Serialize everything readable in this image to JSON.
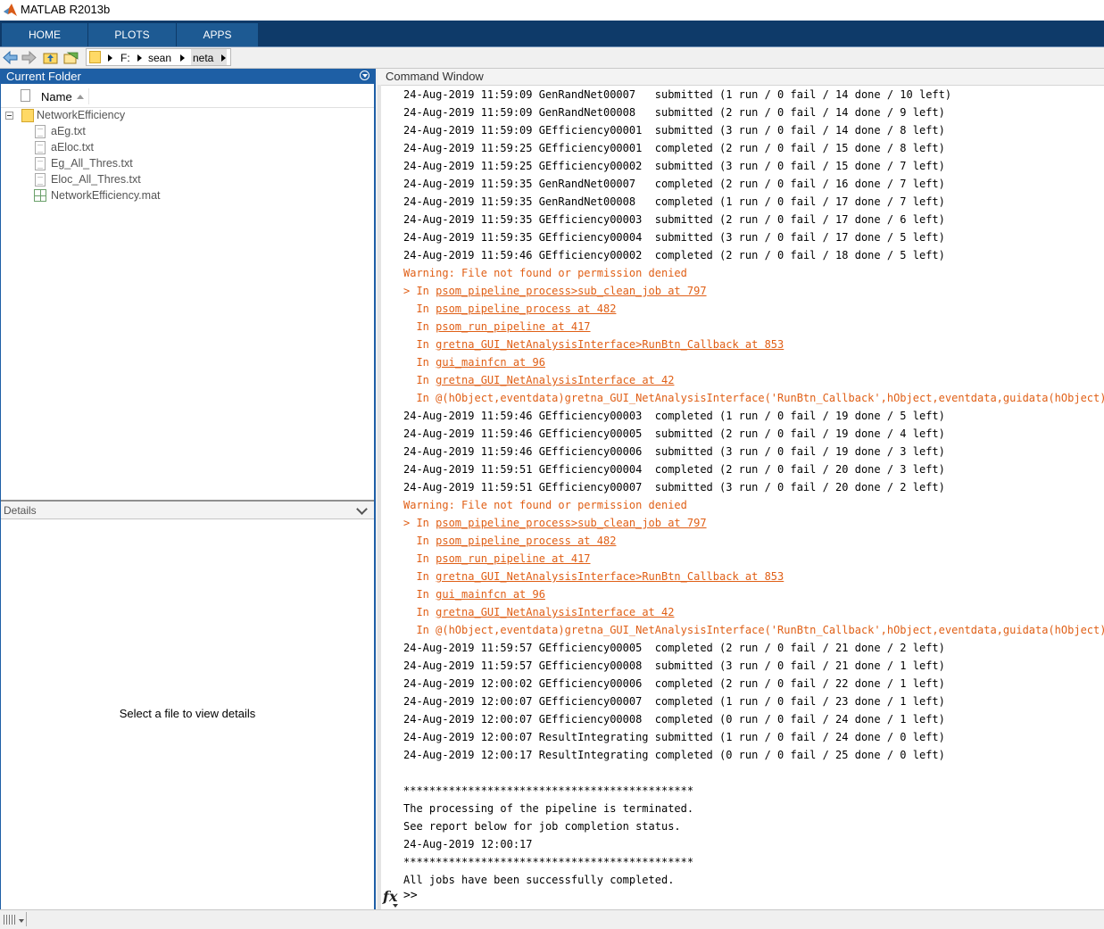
{
  "window": {
    "title": "MATLAB R2013b"
  },
  "ribbon": {
    "tabs": [
      "HOME",
      "PLOTS",
      "APPS"
    ]
  },
  "address_bar": {
    "crumbs": [
      "F:",
      "sean",
      "neta"
    ]
  },
  "current_folder": {
    "title": "Current Folder",
    "column_name": "Name",
    "root_folder": "NetworkEfficiency",
    "files": [
      "aEg.txt",
      "aEloc.txt",
      "Eg_All_Thres.txt",
      "Eloc_All_Thres.txt",
      "NetworkEfficiency.mat"
    ]
  },
  "details": {
    "title": "Details",
    "message": "Select a file to view details"
  },
  "command_window": {
    "title": "Command Window",
    "lines": [
      {
        "t": "24-Aug-2019 11:59:09 GenRandNet00007   submitted (1 run / 0 fail / 14 done / 10 left)",
        "k": "n"
      },
      {
        "t": "24-Aug-2019 11:59:09 GenRandNet00008   submitted (2 run / 0 fail / 14 done / 9 left)",
        "k": "n"
      },
      {
        "t": "24-Aug-2019 11:59:09 GEfficiency00001  submitted (3 run / 0 fail / 14 done / 8 left)",
        "k": "n"
      },
      {
        "t": "24-Aug-2019 11:59:25 GEfficiency00001  completed (2 run / 0 fail / 15 done / 8 left)",
        "k": "n"
      },
      {
        "t": "24-Aug-2019 11:59:25 GEfficiency00002  submitted (3 run / 0 fail / 15 done / 7 left)",
        "k": "n"
      },
      {
        "t": "24-Aug-2019 11:59:35 GenRandNet00007   completed (2 run / 0 fail / 16 done / 7 left)",
        "k": "n"
      },
      {
        "t": "24-Aug-2019 11:59:35 GenRandNet00008   completed (1 run / 0 fail / 17 done / 7 left)",
        "k": "n"
      },
      {
        "t": "24-Aug-2019 11:59:35 GEfficiency00003  submitted (2 run / 0 fail / 17 done / 6 left)",
        "k": "n"
      },
      {
        "t": "24-Aug-2019 11:59:35 GEfficiency00004  submitted (3 run / 0 fail / 17 done / 5 left)",
        "k": "n"
      },
      {
        "t": "24-Aug-2019 11:59:46 GEfficiency00002  completed (2 run / 0 fail / 18 done / 5 left)",
        "k": "n"
      },
      {
        "t": "Warning: File not found or permission denied",
        "k": "w"
      },
      {
        "p": "> In ",
        "link": "psom_pipeline_process>sub_clean_job at 797",
        "k": "l"
      },
      {
        "p": "  In ",
        "link": "psom_pipeline_process at 482",
        "k": "l"
      },
      {
        "p": "  In ",
        "link": "psom_run_pipeline at 417",
        "k": "l"
      },
      {
        "p": "  In ",
        "link": "gretna_GUI_NetAnalysisInterface>RunBtn_Callback at 853",
        "k": "l"
      },
      {
        "p": "  In ",
        "link": "gui_mainfcn at 96",
        "k": "l"
      },
      {
        "p": "  In ",
        "link": "gretna_GUI_NetAnalysisInterface at 42",
        "k": "l"
      },
      {
        "t": "  In @(hObject,eventdata)gretna_GUI_NetAnalysisInterface('RunBtn_Callback',hObject,eventdata,guidata(hObject))",
        "k": "w"
      },
      {
        "t": "24-Aug-2019 11:59:46 GEfficiency00003  completed (1 run / 0 fail / 19 done / 5 left)",
        "k": "n"
      },
      {
        "t": "24-Aug-2019 11:59:46 GEfficiency00005  submitted (2 run / 0 fail / 19 done / 4 left)",
        "k": "n"
      },
      {
        "t": "24-Aug-2019 11:59:46 GEfficiency00006  submitted (3 run / 0 fail / 19 done / 3 left)",
        "k": "n"
      },
      {
        "t": "24-Aug-2019 11:59:51 GEfficiency00004  completed (2 run / 0 fail / 20 done / 3 left)",
        "k": "n"
      },
      {
        "t": "24-Aug-2019 11:59:51 GEfficiency00007  submitted (3 run / 0 fail / 20 done / 2 left)",
        "k": "n"
      },
      {
        "t": "Warning: File not found or permission denied",
        "k": "w"
      },
      {
        "p": "> In ",
        "link": "psom_pipeline_process>sub_clean_job at 797",
        "k": "l"
      },
      {
        "p": "  In ",
        "link": "psom_pipeline_process at 482",
        "k": "l"
      },
      {
        "p": "  In ",
        "link": "psom_run_pipeline at 417",
        "k": "l"
      },
      {
        "p": "  In ",
        "link": "gretna_GUI_NetAnalysisInterface>RunBtn_Callback at 853",
        "k": "l"
      },
      {
        "p": "  In ",
        "link": "gui_mainfcn at 96",
        "k": "l"
      },
      {
        "p": "  In ",
        "link": "gretna_GUI_NetAnalysisInterface at 42",
        "k": "l"
      },
      {
        "t": "  In @(hObject,eventdata)gretna_GUI_NetAnalysisInterface('RunBtn_Callback',hObject,eventdata,guidata(hObject))",
        "k": "w"
      },
      {
        "t": "24-Aug-2019 11:59:57 GEfficiency00005  completed (2 run / 0 fail / 21 done / 2 left)",
        "k": "n"
      },
      {
        "t": "24-Aug-2019 11:59:57 GEfficiency00008  submitted (3 run / 0 fail / 21 done / 1 left)",
        "k": "n"
      },
      {
        "t": "24-Aug-2019 12:00:02 GEfficiency00006  completed (2 run / 0 fail / 22 done / 1 left)",
        "k": "n"
      },
      {
        "t": "24-Aug-2019 12:00:07 GEfficiency00007  completed (1 run / 0 fail / 23 done / 1 left)",
        "k": "n"
      },
      {
        "t": "24-Aug-2019 12:00:07 GEfficiency00008  completed (0 run / 0 fail / 24 done / 1 left)",
        "k": "n"
      },
      {
        "t": "24-Aug-2019 12:00:07 ResultIntegrating submitted (1 run / 0 fail / 24 done / 0 left)",
        "k": "n"
      },
      {
        "t": "24-Aug-2019 12:00:17 ResultIntegrating completed (0 run / 0 fail / 25 done / 0 left)",
        "k": "n"
      },
      {
        "t": "",
        "k": "n"
      },
      {
        "t": "*********************************************",
        "k": "n"
      },
      {
        "t": "The processing of the pipeline is terminated.",
        "k": "n"
      },
      {
        "t": "See report below for job completion status.",
        "k": "n"
      },
      {
        "t": "24-Aug-2019 12:00:17",
        "k": "n"
      },
      {
        "t": "*********************************************",
        "k": "n"
      },
      {
        "t": "All jobs have been successfully completed.",
        "k": "n"
      }
    ],
    "prompt": ">>",
    "fx_label": "fx"
  },
  "colors": {
    "ribbon_bg": "#0e3a69",
    "tab_bg": "#1d5a93",
    "panel_header": "#1e5fa5",
    "warning": "#e05f16"
  },
  "icons": [
    "matlab-logo-icon",
    "back-arrow-icon",
    "forward-arrow-icon",
    "up-folder-icon",
    "browse-folder-icon",
    "folder-icon",
    "file-icon",
    "mat-file-icon",
    "collapse-icon",
    "panel-menu-icon",
    "chevron-down-icon",
    "fx-icon"
  ]
}
